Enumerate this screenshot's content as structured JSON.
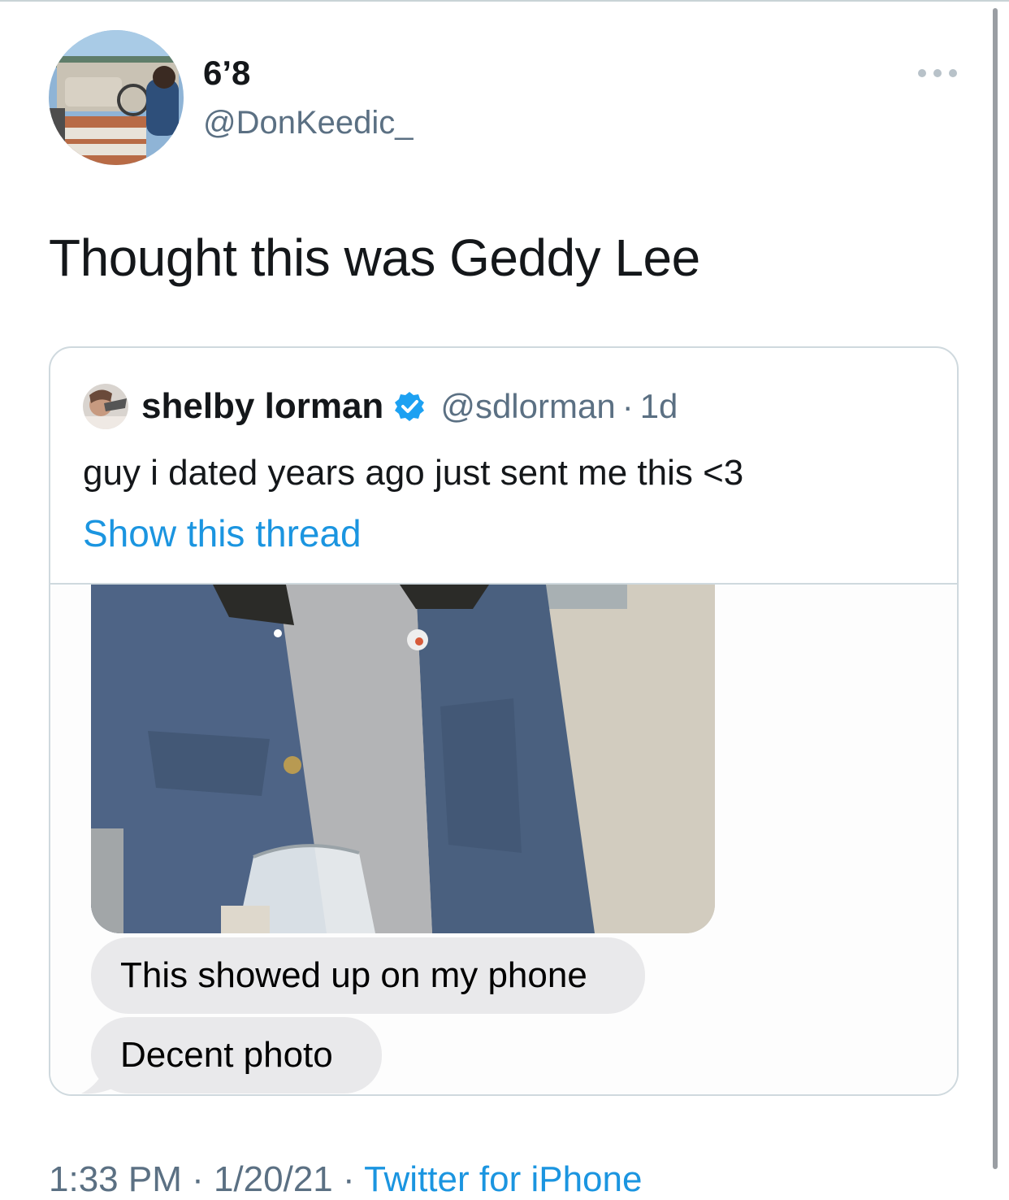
{
  "author": {
    "display_name": "6’8",
    "handle": "@DonKeedic_"
  },
  "tweet": {
    "text": "Thought this was Geddy Lee"
  },
  "quoted": {
    "name": "shelby lorman",
    "verified": true,
    "handle": "@sdlorman",
    "separator": "·",
    "time": "1d",
    "text": "guy i dated years ago just sent me this <3",
    "show_thread": "Show this thread",
    "messages": [
      "This showed up on my phone",
      "Decent photo"
    ]
  },
  "footer": {
    "time_date": "1:33 PM · 1/20/21 · ",
    "source": "Twitter for iPhone"
  },
  "colors": {
    "link": "#1b95e0",
    "secondary_text": "#5b7083",
    "bubble": "#e9e9eb",
    "verified": "#1da1f2"
  },
  "icons": {
    "more": "more-horizontal-icon",
    "verified": "verified-badge-icon"
  }
}
